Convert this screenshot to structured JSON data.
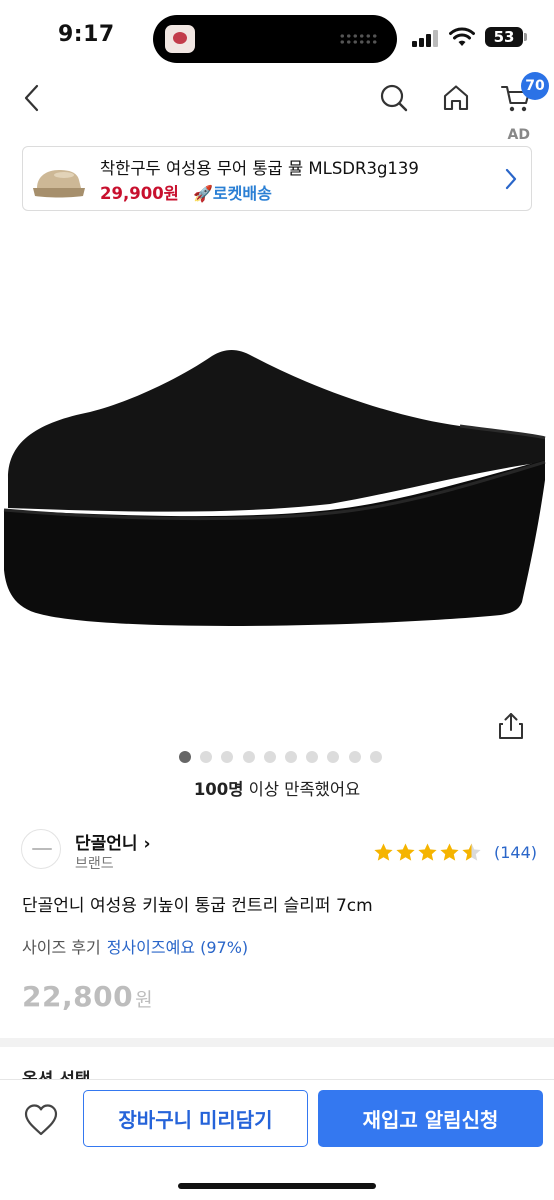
{
  "status_bar": {
    "time": "9:17",
    "battery": "53",
    "icons": [
      "signal-icon",
      "wifi-icon",
      "battery-icon"
    ]
  },
  "header": {
    "icons": [
      "chevron-left-icon",
      "search-icon",
      "home-icon",
      "cart-icon"
    ],
    "cart_count": "70"
  },
  "ad": {
    "label": "AD",
    "title": "착한구두 여성용 무어 통굽 뮬 MLSDR3g139",
    "price": "29,900원",
    "delivery": "🚀로켓배송"
  },
  "gallery": {
    "dot_count": 10,
    "active_index": 0
  },
  "satisfaction": {
    "bold": "100명",
    "rest": " 이상 만족했어요"
  },
  "brand": {
    "name": "단골언니 ›",
    "subtitle": "브랜드"
  },
  "rating": {
    "stars": 4.5,
    "count": "(144)"
  },
  "product": {
    "title": "단골언니 여성용 키높이 통굽 컨트리 슬리퍼 7cm",
    "size_review_label": "사이즈 후기",
    "size_review_value": "정사이즈예요 (97%)",
    "price": "22,800",
    "price_unit": "원"
  },
  "options": {
    "label": "옵션 선택"
  },
  "actions": {
    "cart_label": "장바구니 미리담기",
    "restock_label": "재입고 알림신청"
  },
  "colors": {
    "accent": "#3478f0",
    "ad_price": "#c8102e",
    "rocket": "#2a7fd4",
    "star": "#f5b400"
  }
}
